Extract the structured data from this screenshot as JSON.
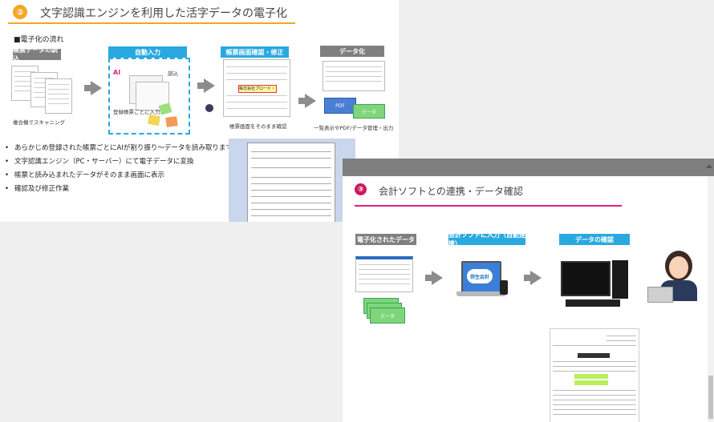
{
  "slide1": {
    "badge": "②",
    "title": "文字認識エンジンを利用した活字データの電子化",
    "subtitle": "■電子化の流れ",
    "steps": [
      {
        "label": "帳票データの読込",
        "caption": "複合機でスキャニング"
      },
      {
        "label": "自動入力",
        "ai": "AI",
        "read": "読込",
        "caption": "登録帳票ごとに入力"
      },
      {
        "label": "帳票画面確認・修正",
        "highlight": "株式会社プロード・",
        "caption": "帳票画面をそのまま確認"
      },
      {
        "label": "データ化",
        "pdf": "PDF",
        "data": "データ",
        "caption": "一覧表示やPDF/データ管理・出力"
      }
    ],
    "bullets": [
      "あらかじめ登録された帳票ごとにAIが割り振り～データを読み取りまで行う",
      "文字認識エンジン（PC・サーバー）にて電子データに変換",
      "帳票と読み込まれたデータがそのまま画面に表示",
      "確認及び修正作業"
    ]
  },
  "slide2": {
    "badge": "③",
    "title": "会計ソフトとの連携・データ確認",
    "steps": [
      {
        "label": "電子化されたデータ",
        "data": "データ"
      },
      {
        "label": "会計ソフトに入力（自動連携）",
        "logo": "弥生会計"
      },
      {
        "label": "データの確認"
      }
    ]
  },
  "colors": {
    "orange": "#f5a623",
    "blue": "#29a9e0",
    "gray": "#7f7f7f",
    "magenta": "#e0237a"
  }
}
